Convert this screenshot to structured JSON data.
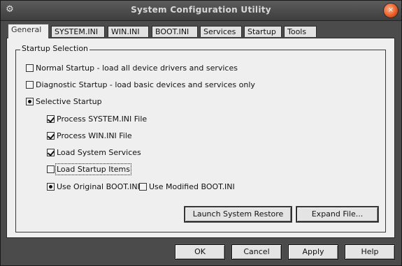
{
  "window": {
    "title": "System Configuration Utility",
    "icon": "msconfig-icon"
  },
  "tabs": [
    {
      "label": "General"
    },
    {
      "label": "SYSTEM.INI"
    },
    {
      "label": "WIN.INI"
    },
    {
      "label": "BOOT.INI"
    },
    {
      "label": "Services"
    },
    {
      "label": "Startup"
    },
    {
      "label": "Tools"
    }
  ],
  "startup_selection": {
    "title": "Startup Selection",
    "normal": {
      "label": "Normal Startup - load all device drivers and services",
      "selected": false
    },
    "diagnostic": {
      "label": "Diagnostic Startup - load basic devices and services only",
      "selected": false
    },
    "selective": {
      "label": "Selective Startup",
      "selected": true
    },
    "items": [
      {
        "label": "Process SYSTEM.INI File",
        "checked": true
      },
      {
        "label": "Process WIN.INI File",
        "checked": true
      },
      {
        "label": "Load System Services",
        "checked": true
      },
      {
        "label": "Load Startup Items",
        "checked": false
      }
    ],
    "boot_original": {
      "label": "Use Original BOOT.INI",
      "selected": true
    },
    "boot_modified": {
      "label": "Use Modified BOOT.INI",
      "checked": false
    }
  },
  "buttons": {
    "restore": "Launch System Restore",
    "expand": "Expand File...",
    "ok": "OK",
    "cancel": "Cancel",
    "apply": "Apply",
    "help": "Help"
  }
}
